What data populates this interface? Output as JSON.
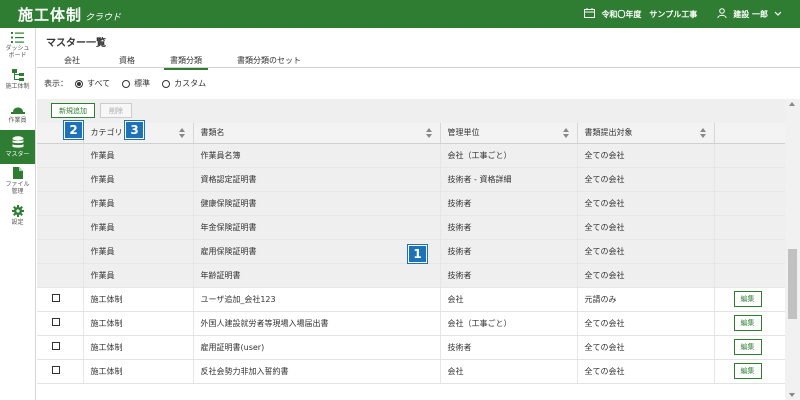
{
  "header": {
    "brand_main": "施工体制",
    "brand_sub": "クラウド",
    "project": "令和〇年度　サンプル工事",
    "user": "建設 一郎"
  },
  "sidebar": {
    "items": [
      {
        "label": "ダッシュ\nボード",
        "icon": "list-icon"
      },
      {
        "label": "施工体制",
        "icon": "org-tree-icon"
      },
      {
        "label": "作業員",
        "icon": "helmet-icon"
      },
      {
        "label": "マスター",
        "icon": "database-icon"
      },
      {
        "label": "ファイル\n管理",
        "icon": "file-icon"
      },
      {
        "label": "設定",
        "icon": "gear-icon"
      }
    ]
  },
  "page": {
    "title": "マスター一覧"
  },
  "tabs": [
    "会社",
    "資格",
    "書類分類",
    "書類分類のセット"
  ],
  "filter": {
    "label": "表示：",
    "options": [
      "すべて",
      "標準",
      "カスタム"
    ],
    "selected": "すべて"
  },
  "toolbar": {
    "add_label": "新規追加",
    "delete_label": "削除"
  },
  "table": {
    "headers": [
      "",
      "カテゴリ",
      "書類名",
      "管理単位",
      "書類提出対象",
      ""
    ],
    "master_rows": [
      [
        "作業員",
        "作業員名簿",
        "会社（工事ごと）",
        "全ての会社"
      ],
      [
        "作業員",
        "資格認定証明書",
        "技術者 - 資格詳細",
        "全ての会社"
      ],
      [
        "作業員",
        "健康保険証明書",
        "技術者",
        "全ての会社"
      ],
      [
        "作業員",
        "年金保険証明書",
        "技術者",
        "全ての会社"
      ],
      [
        "作業員",
        "雇用保険証明書",
        "技術者",
        "全ての会社"
      ],
      [
        "作業員",
        "年齢証明書",
        "技術者",
        "全ての会社"
      ]
    ],
    "custom_rows": [
      [
        "施工体制",
        "ユーザ追加_会社123",
        "会社",
        "元請のみ"
      ],
      [
        "施工体制",
        "外国人建設就労者等現場入場届出書",
        "会社（工事ごと）",
        "全ての会社"
      ],
      [
        "施工体制",
        "雇用証明書(user)",
        "技術者",
        "全ての会社"
      ],
      [
        "施工体制",
        "反社会勢力非加入誓約書",
        "会社",
        "全ての会社"
      ]
    ],
    "edit_label": "編集"
  },
  "badges": [
    "1",
    "2",
    "3"
  ],
  "colors": {
    "brand_green": "#2e7d32",
    "badge_blue": "#1e73b8"
  }
}
